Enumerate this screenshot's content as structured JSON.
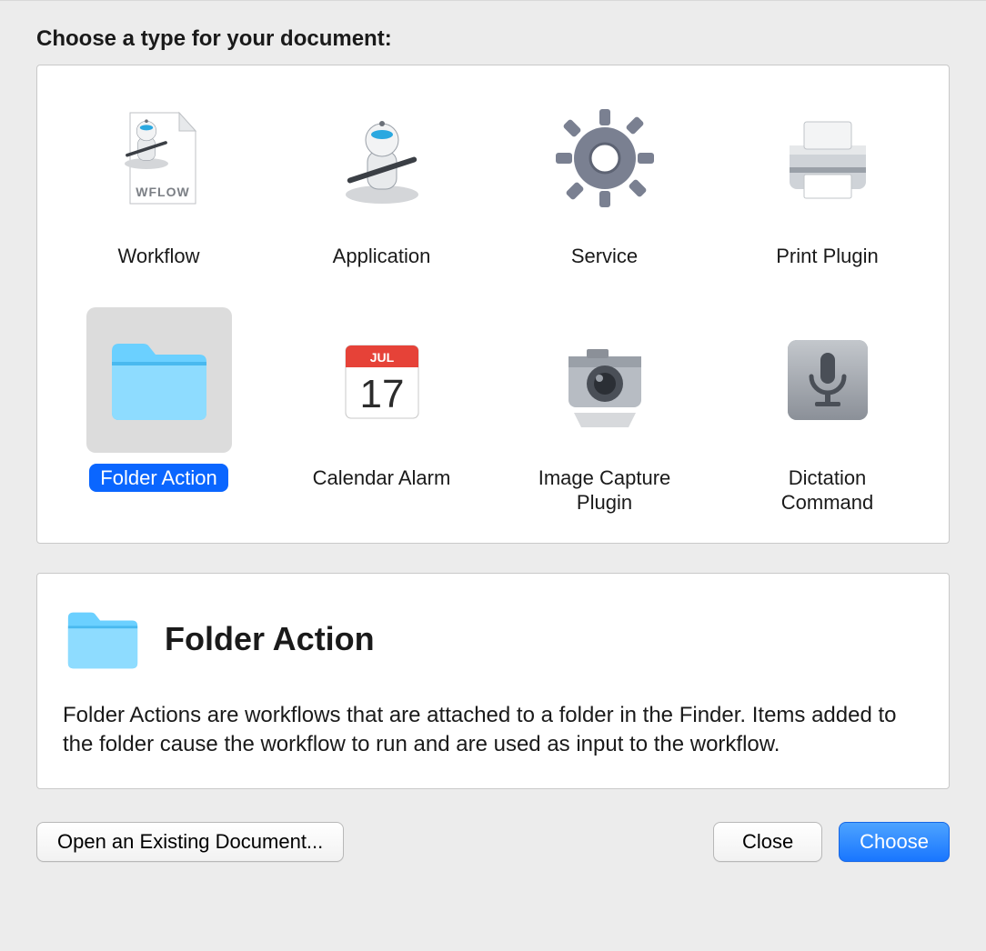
{
  "prompt": "Choose a type for your document:",
  "types": [
    {
      "id": "workflow",
      "label": "Workflow",
      "icon": "workflow"
    },
    {
      "id": "application",
      "label": "Application",
      "icon": "application"
    },
    {
      "id": "service",
      "label": "Service",
      "icon": "service"
    },
    {
      "id": "print-plugin",
      "label": "Print Plugin",
      "icon": "print-plugin"
    },
    {
      "id": "folder-action",
      "label": "Folder Action",
      "icon": "folder-action",
      "selected": true
    },
    {
      "id": "calendar-alarm",
      "label": "Calendar Alarm",
      "icon": "calendar-alarm"
    },
    {
      "id": "image-capture-plugin",
      "label": "Image Capture Plugin",
      "icon": "image-capture-plugin"
    },
    {
      "id": "dictation-command",
      "label": "Dictation Command",
      "icon": "dictation-command"
    }
  ],
  "calendar_icon": {
    "month": "JUL",
    "day": "17"
  },
  "workflow_badge": "WFLOW",
  "description": {
    "title": "Folder Action",
    "icon": "folder-action",
    "text": "Folder Actions are workflows that are attached to a folder in the Finder. Items added to the folder cause the workflow to run and are used as input to the workflow."
  },
  "buttons": {
    "open_existing": "Open an Existing Document...",
    "close": "Close",
    "choose": "Choose"
  },
  "colors": {
    "selection_bg": "#dcdcdc",
    "selection_label": "#0a66ff",
    "primary_button": "#1976ff"
  }
}
